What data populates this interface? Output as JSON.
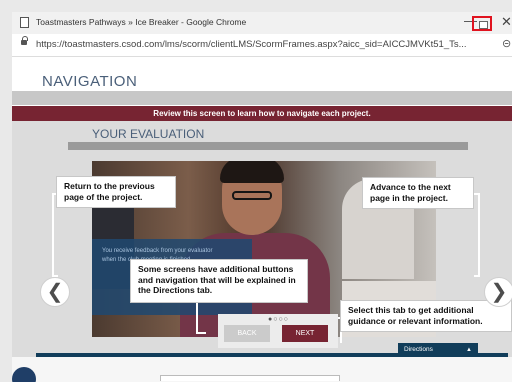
{
  "window": {
    "title": "Toastmasters Pathways » Ice Breaker - Google Chrome",
    "minimize_glyph": "—",
    "close_glyph": "✕",
    "url": "https://toastmasters.csod.com/lms/scorm/clientLMS/ScormFrames.aspx?aicc_sid=AICCJMVKt51_Ts...",
    "url_overflow_glyph": "⊝"
  },
  "page": {
    "title": "NAVIGATION",
    "banner": "Review this screen to learn how to navigate each project.",
    "section_title": "YOUR EVALUATION",
    "screen_text": "You receive feedback from your evaluator when the club meeting is finished. ...",
    "prev_arrow": "❮",
    "next_arrow": "❯",
    "page_dots": "●○○○",
    "back_label": "BACK",
    "next_label": "NEXT",
    "directions_label": "Directions",
    "directions_caret": "▲"
  },
  "callouts": {
    "prev": "Return to the previous page of the project.",
    "next": "Advance to the next page in the project.",
    "screens": "Some screens have additional buttons and navigation that will be explained in the Directions tab.",
    "tab": "Select this tab to get additional guidance or relevant information."
  },
  "colors": {
    "brand_maroon": "#772432",
    "title_blue": "#4a5f79",
    "bar_navy": "#113d5a",
    "highlight_red": "#e0131f"
  }
}
